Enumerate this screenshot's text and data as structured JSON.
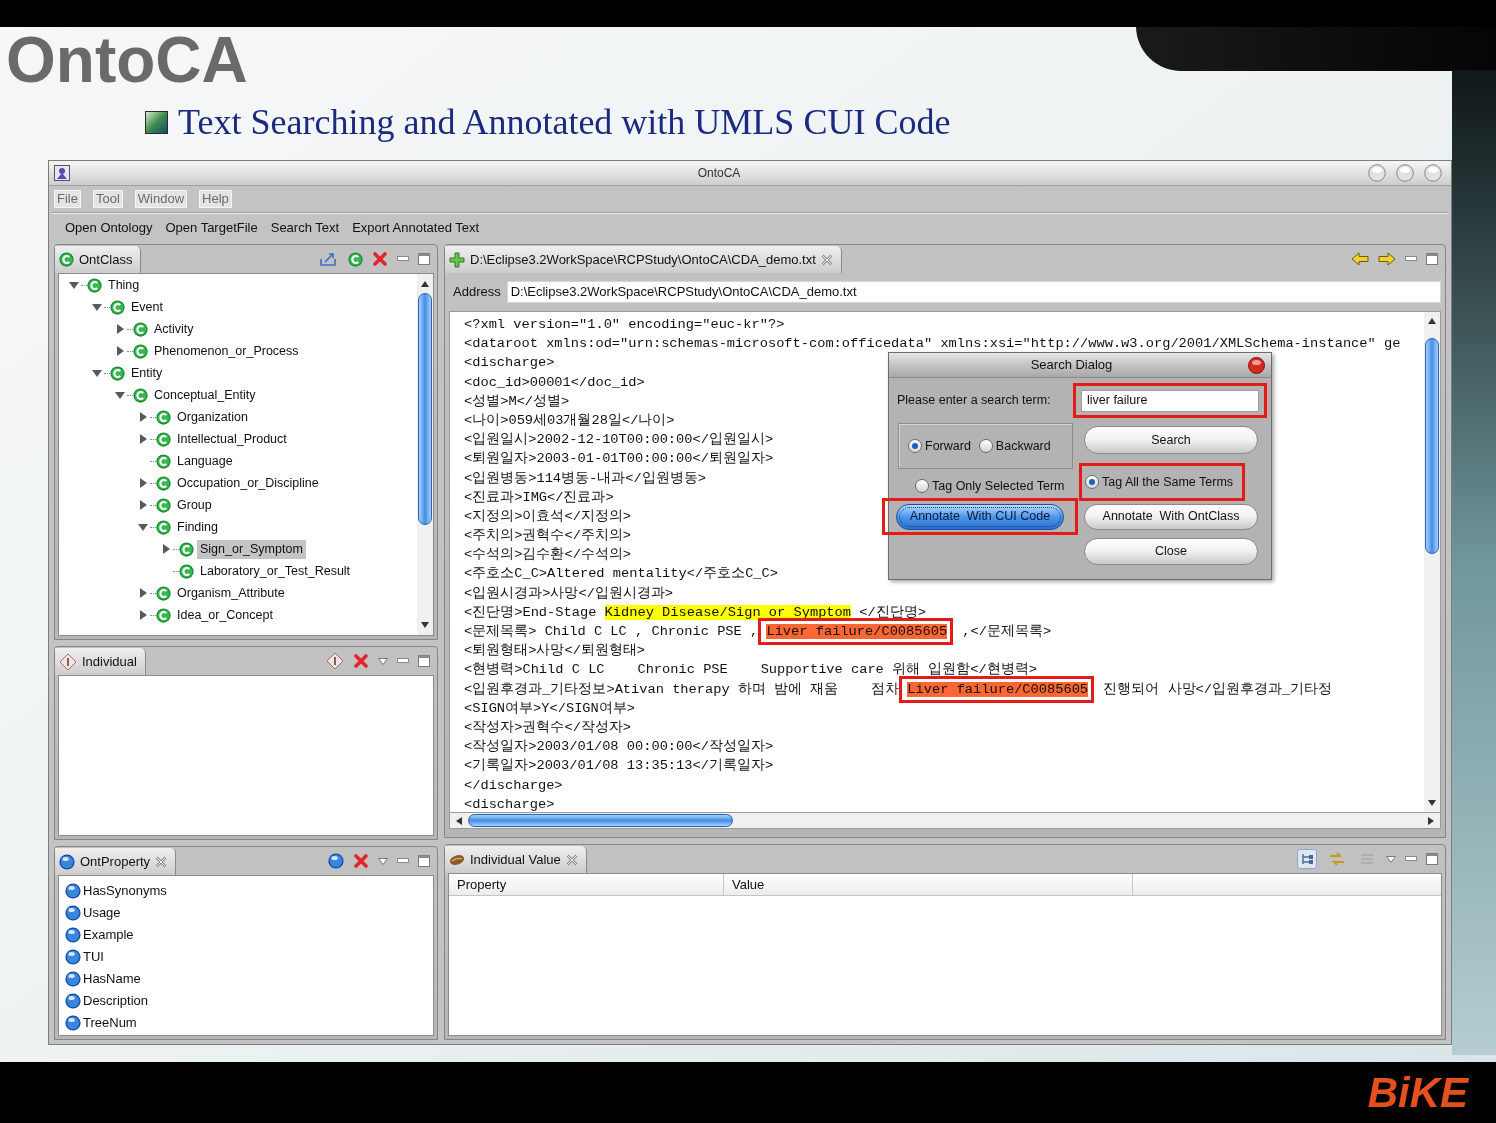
{
  "slide": {
    "title": "OntoCA",
    "subtitle": "Text Searching and Annotated with UMLS CUI Code",
    "logo": "BiKE"
  },
  "window": {
    "title": "OntoCA"
  },
  "menu_bar": [
    "File",
    "Tool",
    "Window",
    "Help"
  ],
  "toolbar": [
    "Open Ontology",
    "Open TargetFile",
    "Search Text",
    "Export Annotated Text"
  ],
  "ontclass_panel": {
    "tab": "OntClass",
    "tree": [
      {
        "label": "Thing",
        "kind": "branch",
        "expanded": true,
        "selected": false,
        "children": [
          {
            "label": "Event",
            "kind": "branch",
            "expanded": true,
            "selected": false,
            "children": [
              {
                "label": "Activity",
                "kind": "branch",
                "expanded": false,
                "selected": false
              },
              {
                "label": "Phenomenon_or_Process",
                "kind": "branch",
                "expanded": false,
                "selected": false
              }
            ]
          },
          {
            "label": "Entity",
            "kind": "branch",
            "expanded": true,
            "selected": false,
            "children": [
              {
                "label": "Conceptual_Entity",
                "kind": "branch",
                "expanded": true,
                "selected": false,
                "children": [
                  {
                    "label": "Organization",
                    "kind": "branch",
                    "expanded": false,
                    "selected": false
                  },
                  {
                    "label": "Intellectual_Product",
                    "kind": "branch",
                    "expanded": false,
                    "selected": false
                  },
                  {
                    "label": "Language",
                    "kind": "leaf",
                    "selected": false
                  },
                  {
                    "label": "Occupation_or_Discipline",
                    "kind": "branch",
                    "expanded": false,
                    "selected": false
                  },
                  {
                    "label": "Group",
                    "kind": "branch",
                    "expanded": false,
                    "selected": false
                  },
                  {
                    "label": "Finding",
                    "kind": "branch",
                    "expanded": true,
                    "selected": false,
                    "children": [
                      {
                        "label": "Sign_or_Symptom",
                        "kind": "branch",
                        "expanded": false,
                        "selected": true
                      },
                      {
                        "label": "Laboratory_or_Test_Result",
                        "kind": "leaf",
                        "selected": false
                      }
                    ]
                  },
                  {
                    "label": "Organism_Attribute",
                    "kind": "branch",
                    "expanded": false,
                    "selected": false
                  },
                  {
                    "label": "Idea_or_Concept",
                    "kind": "branch",
                    "expanded": false,
                    "selected": false
                  }
                ]
              }
            ]
          }
        ]
      }
    ]
  },
  "individual_panel": {
    "tab": "Individual"
  },
  "ontproperty_panel": {
    "tab": "OntProperty",
    "items": [
      "HasSynonyms",
      "Usage",
      "Example",
      "TUI",
      "HasName",
      "Description",
      "TreeNum"
    ]
  },
  "editor": {
    "tab": "D:\\Eclipse3.2WorkSpace\\RCPStudy\\OntoCA\\CDA_demo.txt",
    "address_label": "Address",
    "address": "D:\\Eclipse3.2WorkSpace\\RCPStudy\\OntoCA\\CDA_demo.txt",
    "lines": [
      {
        "segments": [
          {
            "kind": "text",
            "text": "<?xml version=\"1.0\" encoding=\"euc-kr\"?>"
          }
        ]
      },
      {
        "segments": [
          {
            "kind": "text",
            "text": "<dataroot xmlns:od=\"urn:schemas-microsoft-com:officedata\" xmlns:xsi=\"http://www.w3.org/2001/XMLSchema-instance\" ge"
          }
        ]
      },
      {
        "segments": [
          {
            "kind": "text",
            "text": "<discharge>"
          }
        ]
      },
      {
        "segments": [
          {
            "kind": "text",
            "text": "<doc_id>00001</doc_id>"
          }
        ]
      },
      {
        "segments": [
          {
            "kind": "text",
            "text": "<성별>M</성별>"
          }
        ]
      },
      {
        "segments": [
          {
            "kind": "text",
            "text": "<나이>059세03개월28일</나이>"
          }
        ]
      },
      {
        "segments": [
          {
            "kind": "text",
            "text": "<입원일시>2002-12-10T00:00:00</입원일시>"
          }
        ]
      },
      {
        "segments": [
          {
            "kind": "text",
            "text": "<퇴원일자>2003-01-01T00:00:00</퇴원일자>"
          }
        ]
      },
      {
        "segments": [
          {
            "kind": "text",
            "text": "<입원병동>114병동-내과</입원병동>"
          }
        ]
      },
      {
        "segments": [
          {
            "kind": "text",
            "text": "<진료과>IMG</진료과>"
          }
        ]
      },
      {
        "segments": [
          {
            "kind": "text",
            "text": "<지정의>이효석</지정의>"
          }
        ]
      },
      {
        "segments": [
          {
            "kind": "text",
            "text": "<주치의>권혁수</주치의>"
          }
        ]
      },
      {
        "segments": [
          {
            "kind": "text",
            "text": "<수석의>김수환</수석의>"
          }
        ]
      },
      {
        "segments": [
          {
            "kind": "text",
            "text": "<주호소C_C>Altered mentality</주호소C_C>"
          }
        ]
      },
      {
        "segments": [
          {
            "kind": "text",
            "text": "<입원시경과>사망</입원시경과>"
          }
        ]
      },
      {
        "segments": [
          {
            "kind": "text",
            "text": "<진단명>End-Stage "
          },
          {
            "kind": "term",
            "text": "Kidney Disease/Sign or Symptom",
            "color": "#ffff00",
            "framed": false
          },
          {
            "kind": "text",
            "text": " </진단명>"
          }
        ]
      },
      {
        "segments": [
          {
            "kind": "text",
            "text": "<문제목록> Child C LC , Chronic PSE , "
          },
          {
            "kind": "term",
            "text": "Liver failure/C0085605",
            "color": "#ff6633",
            "framed": true
          },
          {
            "kind": "text",
            "text": " ,</문제목록>"
          }
        ]
      },
      {
        "segments": [
          {
            "kind": "text",
            "text": "<퇴원형태>사망</퇴원형태>"
          }
        ]
      },
      {
        "segments": [
          {
            "kind": "text",
            "text": "<현병력>Child C LC    Chronic PSE    Supportive care 위해 입원함</현병력>"
          }
        ]
      },
      {
        "segments": [
          {
            "kind": "text",
            "text": "<입원후경과_기타정보>Ativan therapy 하며 밤에 재움    점차 "
          },
          {
            "kind": "term",
            "text": "Liver failure/C0085605",
            "color": "#ff6633",
            "framed": true
          },
          {
            "kind": "text",
            "text": " 진행되어 사망</입원후경과_기타정"
          }
        ]
      },
      {
        "segments": [
          {
            "kind": "text",
            "text": "<SIGN여부>Y</SIGN여부>"
          }
        ]
      },
      {
        "segments": [
          {
            "kind": "text",
            "text": "<작성자>권혁수</작성자>"
          }
        ]
      },
      {
        "segments": [
          {
            "kind": "text",
            "text": "<작성일자>2003/01/08 00:00:00</작성일자>"
          }
        ]
      },
      {
        "segments": [
          {
            "kind": "text",
            "text": "<기록일자>2003/01/08 13:35:13</기록일자>"
          }
        ]
      },
      {
        "segments": [
          {
            "kind": "text",
            "text": "</discharge>"
          }
        ]
      },
      {
        "segments": [
          {
            "kind": "text",
            "text": "<discharge>"
          }
        ]
      }
    ]
  },
  "search_dialog": {
    "title": "Search Dialog",
    "prompt": "Please enter a search term:",
    "search_field": {
      "value": "liver failure",
      "framed": true
    },
    "direction": [
      {
        "label": "Forward",
        "selected": true
      },
      {
        "label": "Backward",
        "selected": false
      }
    ],
    "tag_scope": [
      {
        "label": "Tag Only Selected Term",
        "selected": false,
        "framed": false
      },
      {
        "label": "Tag All the Same Terms",
        "selected": true,
        "framed": true
      }
    ],
    "buttons": [
      {
        "label": "Search",
        "focused": false,
        "framed": false
      },
      {
        "label": "Annotate  With CUI Code",
        "focused": true,
        "framed": true
      },
      {
        "label": "Annotate  With OntClass",
        "focused": false,
        "framed": false
      },
      {
        "label": "Close",
        "focused": false,
        "framed": false
      }
    ]
  },
  "individual_value_panel": {
    "tab": "Individual Value",
    "view_buttons": [
      {
        "kind": "tree",
        "pressed": true,
        "disabled": false
      },
      {
        "kind": "arrows",
        "pressed": false,
        "disabled": false
      },
      {
        "kind": "list",
        "pressed": false,
        "disabled": true
      }
    ],
    "columns": [
      "Property",
      "Value"
    ]
  }
}
